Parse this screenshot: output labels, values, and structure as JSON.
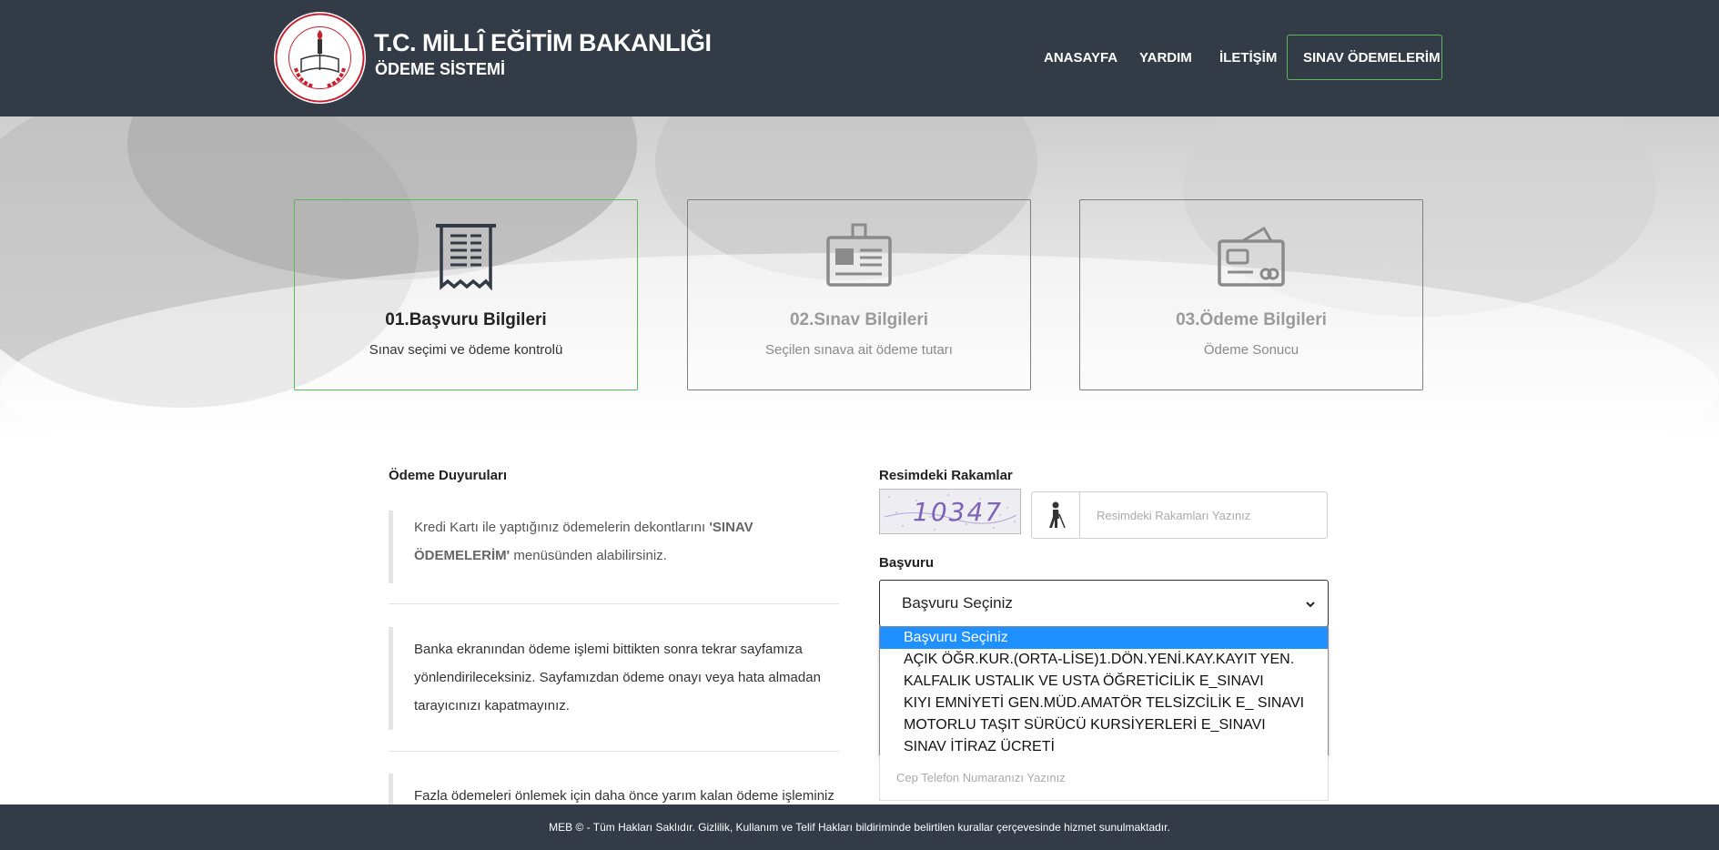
{
  "header": {
    "brand_title": "T.C. MİLLÎ EĞİTİM BAKANLIĞI",
    "brand_subtitle": "ÖDEME SİSTEMİ",
    "logo_text": "T.C. MİLLÎ EĞİTİM BAKANLIĞI",
    "nav": [
      {
        "label": "ANASAYFA"
      },
      {
        "label": "YARDIM"
      },
      {
        "label": "İLETİŞİM"
      },
      {
        "label": "SINAV ÖDEMELERİM"
      }
    ]
  },
  "steps": [
    {
      "title": "01.Başvuru Bilgileri",
      "desc": "Sınav seçimi ve ödeme kontrolü",
      "icon": "receipt-icon",
      "active": true
    },
    {
      "title": "02.Sınav Bilgileri",
      "desc": "Seçilen sınava ait ödeme tutarı",
      "icon": "id-card-icon",
      "active": false
    },
    {
      "title": "03.Ödeme Bilgileri",
      "desc": "Ödeme Sonucu",
      "icon": "credit-card-icon",
      "active": false
    }
  ],
  "announcements": {
    "heading": "Ödeme Duyuruları",
    "items": [
      {
        "before": "Kredi Kartı ile yaptığınız ödemelerin dekontlarını ",
        "bold": "'SINAV ÖDEMELERİM'",
        "after": " menüsünden alabilirsiniz."
      },
      {
        "text": "Banka ekranından ödeme işlemi bittikten sonra tekrar sayfamıza yönlendirileceksiniz. Sayfamızdan ödeme onayı veya hata almadan tarayıcınızı kapatmayınız."
      },
      {
        "text": "Fazla ödemeleri önlemek için daha önce yarım kalan ödeme işleminiz var"
      }
    ]
  },
  "form": {
    "captcha_label": "Resimdeki Rakamlar",
    "captcha_text": "10347",
    "captcha_placeholder": "Resimdeki Rakamları Yazınız",
    "basvuru_label": "Başvuru",
    "basvuru_selected": "Başvuru Seçiniz",
    "basvuru_options": [
      "Başvuru Seçiniz",
      "AÇIK ÖĞR.KUR.(ORTA-LİSE)1.DÖN.YENİ.KAY.KAYIT YEN.",
      "KALFALIK USTALIK VE USTA ÖĞRETİCİLİK E_SINAVI",
      "KIYI EMNİYETİ GEN.MÜD.AMATÖR TELSİZCİLİK E_ SINAVI",
      "MOTORLU TAŞIT SÜRÜCÜ KURSİYERLERİ E_SINAVI",
      "SINAV İTİRAZ ÜCRETİ"
    ],
    "phone_placeholder": "Cep Telefon Numaranızı Yazınız"
  },
  "footer": {
    "text": "MEB © - Tüm Hakları Saklıdır. Gizlilik, Kullanım ve Telif Hakları bildiriminde belirtilen kurallar çerçevesinde hizmet sunulmaktadır."
  },
  "colors": {
    "header_bg": "#333b47",
    "accent_green": "#5cb85c",
    "dropdown_highlight": "#1e90ff",
    "logo_red": "#c8202f"
  }
}
